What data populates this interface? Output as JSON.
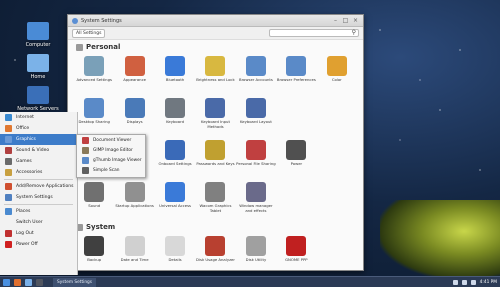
{
  "desktop": {
    "icons": [
      {
        "label": "Computer",
        "icon": "computer-icon",
        "color": "#4a8bd6"
      },
      {
        "label": "Home",
        "icon": "home-folder-icon",
        "color": "#7bb2e8"
      },
      {
        "label": "Network Servers",
        "icon": "network-icon",
        "color": "#3a6fb8"
      }
    ]
  },
  "start_menu": {
    "items": [
      {
        "label": "Internet",
        "icon": "globe-icon",
        "color": "#3a8ad0"
      },
      {
        "label": "Office",
        "icon": "office-icon",
        "color": "#e07830"
      },
      {
        "label": "Graphics",
        "icon": "graphics-icon",
        "color": "#6a9ad8",
        "active": true
      },
      {
        "label": "Sound & Video",
        "icon": "media-icon",
        "color": "#b04040"
      },
      {
        "label": "Games",
        "icon": "games-icon",
        "color": "#6a6a6a"
      },
      {
        "label": "Accessories",
        "icon": "accessories-icon",
        "color": "#c8a040"
      },
      {
        "label": "Add/Remove Applications",
        "icon": "package-icon",
        "color": "#d05030"
      },
      {
        "label": "System Settings",
        "icon": "settings-icon",
        "color": "#5080c0"
      },
      {
        "label": "Places",
        "icon": "places-icon",
        "color": "#4a8ad0"
      },
      {
        "label": "Switch User",
        "icon": "",
        "color": "transparent"
      },
      {
        "label": "Log Out",
        "icon": "logout-icon",
        "color": "#c03030"
      },
      {
        "label": "Power Off",
        "icon": "power-icon",
        "color": "#d02020"
      }
    ],
    "submenu": [
      {
        "label": "Document Viewer",
        "icon": "document-viewer-icon",
        "color": "#c04040"
      },
      {
        "label": "GIMP Image Editor",
        "icon": "gimp-icon",
        "color": "#8a7a5a"
      },
      {
        "label": "gThumb Image Viewer",
        "icon": "image-viewer-icon",
        "color": "#5a8ac8"
      },
      {
        "label": "Simple Scan",
        "icon": "scanner-icon",
        "color": "#606060"
      }
    ]
  },
  "window": {
    "title": "System Settings",
    "breadcrumb": "All Settings",
    "search_placeholder": "",
    "personal_heading": "Personal",
    "personal": [
      {
        "label": "Advanced Settings",
        "icon": "tools-icon",
        "color": "#7aa0b8"
      },
      {
        "label": "Appearance",
        "icon": "appearance-icon",
        "color": "#d06040"
      },
      {
        "label": "Bluetooth",
        "icon": "bluetooth-icon",
        "color": "#3a7ad8"
      },
      {
        "label": "Brightness and Lock",
        "icon": "brightness-icon",
        "color": "#d8b840"
      },
      {
        "label": "Browser Accounts",
        "icon": "browser-accounts-icon",
        "color": "#5a8ac8"
      },
      {
        "label": "Browser Preferences",
        "icon": "browser-preferences-icon",
        "color": "#5a8ac8"
      },
      {
        "label": "Color",
        "icon": "color-icon",
        "color": "#e0a030"
      },
      {
        "label": "Desktop Sharing",
        "icon": "desktop-sharing-icon",
        "color": "#5a8ac8"
      },
      {
        "label": "Displays",
        "icon": "displays-icon",
        "color": "#4a7ab8"
      },
      {
        "label": "Keyboard",
        "icon": "keyboard-icon",
        "color": "#707880"
      },
      {
        "label": "Keyboard Input Methods",
        "icon": "input-methods-icon",
        "color": "#4a6aa8"
      },
      {
        "label": "Keyboard Layout",
        "icon": "keyboard-layout-icon",
        "color": "#4a6aa8"
      },
      {
        "label": "",
        "icon": "",
        "color": "transparent"
      },
      {
        "label": "",
        "icon": "",
        "color": "transparent"
      },
      {
        "label": "",
        "icon": "",
        "color": "transparent"
      },
      {
        "label": "",
        "icon": "",
        "color": "transparent"
      },
      {
        "label": "Onboard Settings",
        "icon": "onboard-icon",
        "color": "#3a6ab8"
      },
      {
        "label": "Passwords and Keys",
        "icon": "passwords-icon",
        "color": "#c0a030"
      },
      {
        "label": "Personal File Sharing",
        "icon": "file-sharing-icon",
        "color": "#c04040"
      },
      {
        "label": "Power",
        "icon": "power-settings-icon",
        "color": "#505050"
      },
      {
        "label": "",
        "icon": "",
        "color": "transparent"
      },
      {
        "label": "Sound",
        "icon": "sound-icon",
        "color": "#707070"
      },
      {
        "label": "Startup Applications",
        "icon": "startup-icon",
        "color": "#909090"
      },
      {
        "label": "Universal Access",
        "icon": "universal-access-icon",
        "color": "#3a7ad8"
      },
      {
        "label": "Wacom Graphics Tablet",
        "icon": "wacom-icon",
        "color": "#808080"
      },
      {
        "label": "Window manager and effects",
        "icon": "window-manager-icon",
        "color": "#6a6a8a"
      },
      {
        "label": "",
        "icon": "",
        "color": "transparent"
      },
      {
        "label": "",
        "icon": "",
        "color": "transparent"
      }
    ],
    "system_heading": "System",
    "system": [
      {
        "label": "Backup",
        "icon": "backup-icon",
        "color": "#404040"
      },
      {
        "label": "Date and Time",
        "icon": "clock-icon",
        "color": "#d0d0d0"
      },
      {
        "label": "Details",
        "icon": "details-icon",
        "color": "#d8d8d8"
      },
      {
        "label": "Disk Usage Analyzer",
        "icon": "disk-usage-icon",
        "color": "#b84030"
      },
      {
        "label": "Disk Utility",
        "icon": "disk-utility-icon",
        "color": "#a0a0a0"
      },
      {
        "label": "GNOME PPP",
        "icon": "phone-icon",
        "color": "#c02020"
      },
      {
        "label": "",
        "icon": "",
        "color": "transparent"
      }
    ]
  },
  "taskbar": {
    "task_label": "System Settings",
    "clock": "4:41 PM"
  }
}
